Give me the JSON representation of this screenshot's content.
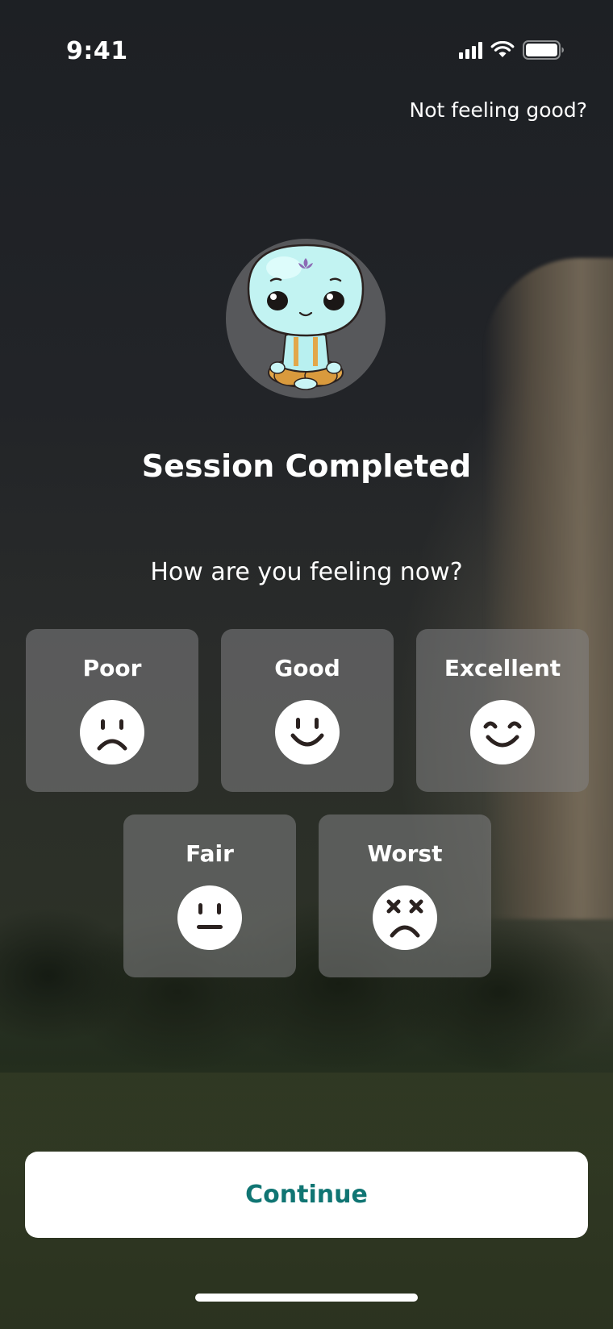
{
  "status_bar": {
    "time": "9:41"
  },
  "header": {
    "help_link": "Not feeling good?"
  },
  "session": {
    "title": "Session Completed",
    "question": "How are you feeling now?"
  },
  "moods": [
    {
      "label": "Poor",
      "icon": "sad-face-icon"
    },
    {
      "label": "Good",
      "icon": "smile-face-icon"
    },
    {
      "label": "Excellent",
      "icon": "happy-face-icon"
    },
    {
      "label": "Fair",
      "icon": "neutral-face-icon"
    },
    {
      "label": "Worst",
      "icon": "dizzy-face-icon"
    }
  ],
  "actions": {
    "continue_label": "Continue"
  },
  "colors": {
    "accent": "#107573",
    "card_bg": "rgba(130,130,132,0.55)",
    "face_stroke": "#2b2220"
  }
}
